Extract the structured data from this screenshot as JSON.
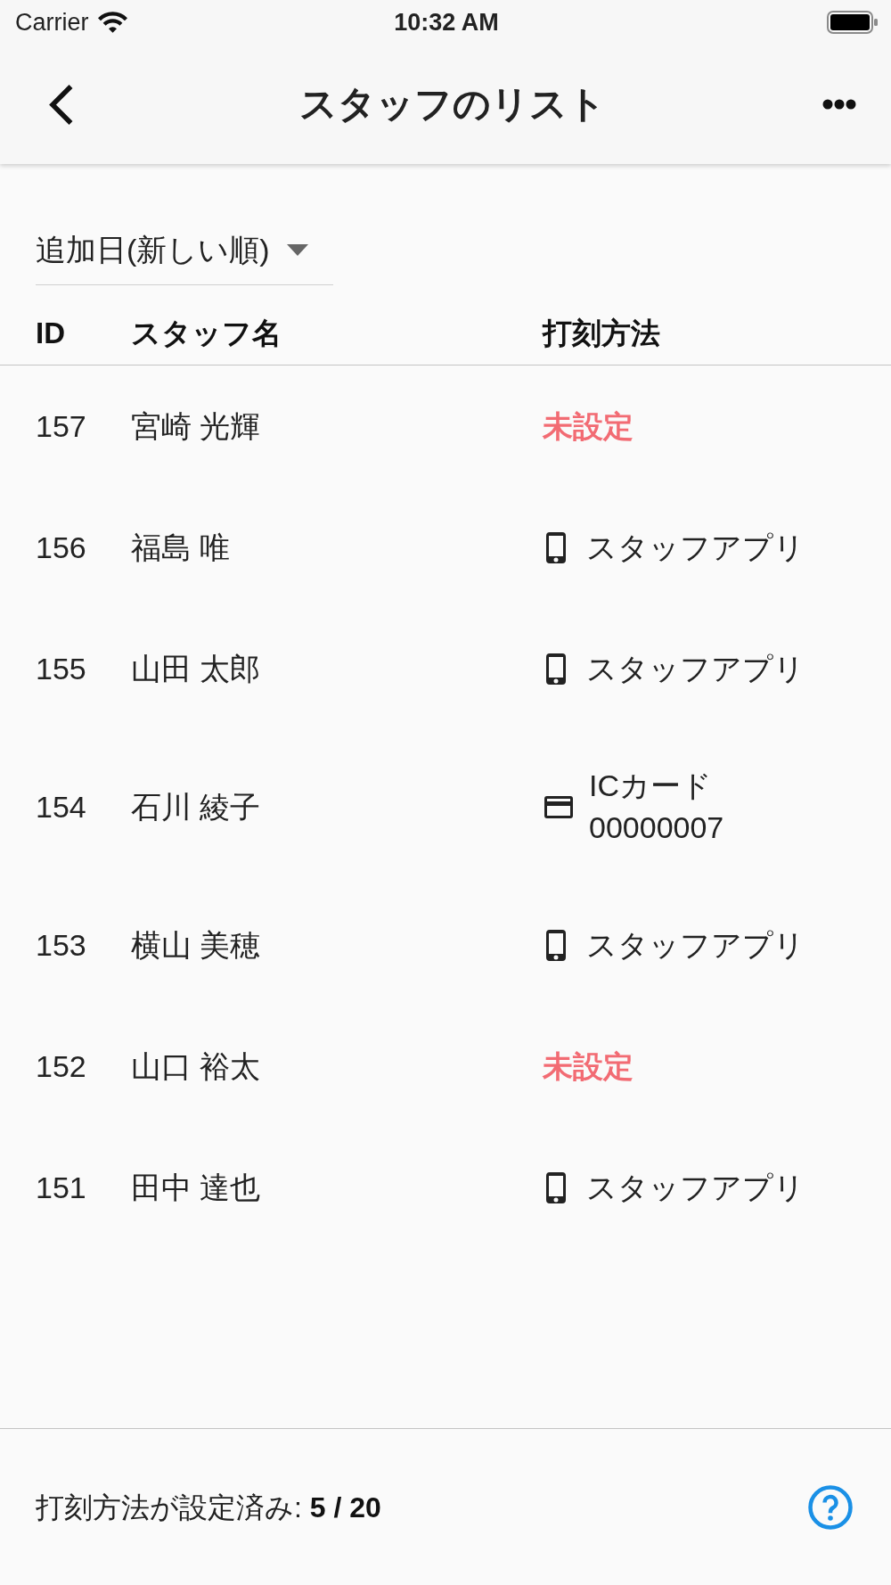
{
  "status_bar": {
    "carrier": "Carrier",
    "time": "10:32 AM"
  },
  "nav_bar": {
    "title": "スタッフのリスト"
  },
  "sort": {
    "value": "追加日(新しい順)"
  },
  "table": {
    "columns": [
      "ID",
      "スタッフ名",
      "打刻方法"
    ],
    "rows": [
      {
        "id": "157",
        "name": "宮崎 光輝",
        "method": {
          "kind": "unset",
          "label": "未設定"
        }
      },
      {
        "id": "156",
        "name": "福島 唯",
        "method": {
          "kind": "app",
          "label": "スタッフアプリ"
        }
      },
      {
        "id": "155",
        "name": "山田 太郎",
        "method": {
          "kind": "app",
          "label": "スタッフアプリ"
        }
      },
      {
        "id": "154",
        "name": "石川 綾子",
        "method": {
          "kind": "ic_card",
          "label": "ICカード",
          "card_number": "00000007"
        }
      },
      {
        "id": "153",
        "name": "横山 美穂",
        "method": {
          "kind": "app",
          "label": "スタッフアプリ"
        }
      },
      {
        "id": "152",
        "name": "山口 裕太",
        "method": {
          "kind": "unset",
          "label": "未設定"
        }
      },
      {
        "id": "151",
        "name": "田中 達也",
        "method": {
          "kind": "app",
          "label": "スタッフアプリ"
        }
      }
    ]
  },
  "footer": {
    "summary": "打刻方法が設定済み: **5 / 20**"
  }
}
